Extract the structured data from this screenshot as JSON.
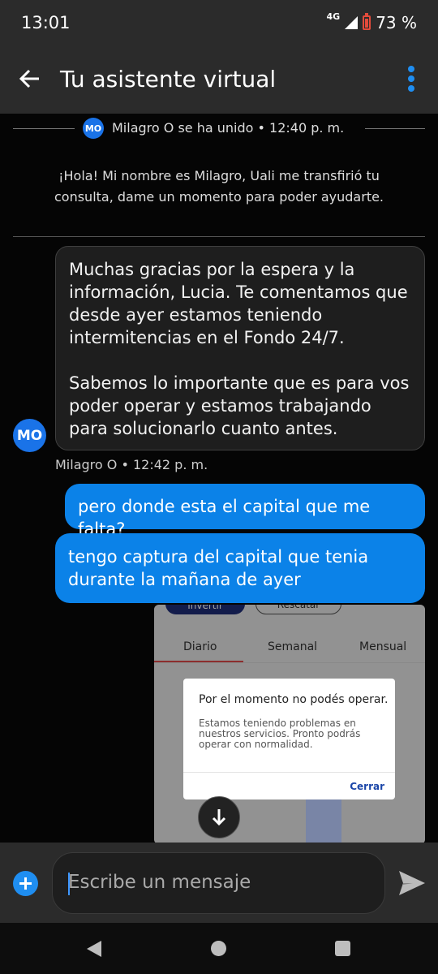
{
  "status_bar": {
    "time": "13:01",
    "network": "4G",
    "battery": "73 %"
  },
  "header": {
    "title": "Tu asistente virtual"
  },
  "join_notice": {
    "avatar": "MO",
    "text": "Milagro O se ha unido • 12:40 p. m."
  },
  "system_message": "¡Hola! Mi nombre es Milagro, Uali me transfirió tu consulta, dame un momento para poder ayudarte.",
  "agent_message": {
    "avatar": "MO",
    "paragraphs": [
      "Muchas gracias por la espera y la información, Lucia. Te comentamos que desde ayer estamos teniendo intermitencias en el Fondo 24/7.",
      "Sabemos lo importante que es para vos poder operar y estamos trabajando para solucionarlo cuanto antes."
    ],
    "meta": "Milagro O • 12:42 p. m."
  },
  "user_messages": [
    "pero donde esta el capital que me falta?",
    "tengo captura del capital que tenia durante la mañana de ayer"
  ],
  "attachment": {
    "buttons": [
      "Invertir",
      "Rescatar"
    ],
    "tabs": [
      "Diario",
      "Semanal",
      "Mensual"
    ],
    "dialog": {
      "title": "Por el momento no podés operar.",
      "body": "Estamos teniendo problemas en nuestros servicios. Pronto podrás operar con normalidad.",
      "button": "Cerrar"
    }
  },
  "composer": {
    "placeholder": "Escribe un mensaje"
  },
  "icons": {
    "back": "arrow-left-icon",
    "menu": "more-vert-icon",
    "add": "plus-circle-icon",
    "send": "send-icon",
    "scroll": "arrow-down-icon"
  },
  "colors": {
    "accent": "#0b82e8",
    "surface": "#2b2b2b",
    "background": "#050505"
  }
}
